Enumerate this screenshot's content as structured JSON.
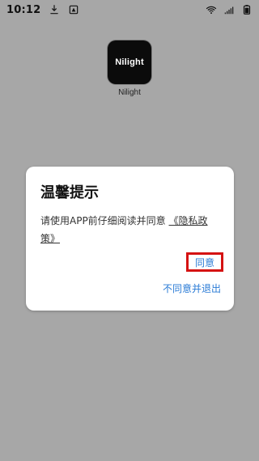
{
  "status_bar": {
    "time": "10:12"
  },
  "app": {
    "icon_text": "Nilight",
    "name": "Nilight"
  },
  "dialog": {
    "title": "温馨提示",
    "message_prefix": "请使用APP前仔细阅读并同意",
    "policy_link_text": "《隐私政策》",
    "agree_label": "同意",
    "disagree_label": "不同意并退出"
  },
  "colors": {
    "accent_blue": "#2a7bd6",
    "highlight_red": "#d51212"
  },
  "icons": {
    "download": "download-icon",
    "alert": "alert-icon",
    "wifi": "wifi-icon",
    "signal": "signal-icon",
    "battery": "battery-icon"
  }
}
